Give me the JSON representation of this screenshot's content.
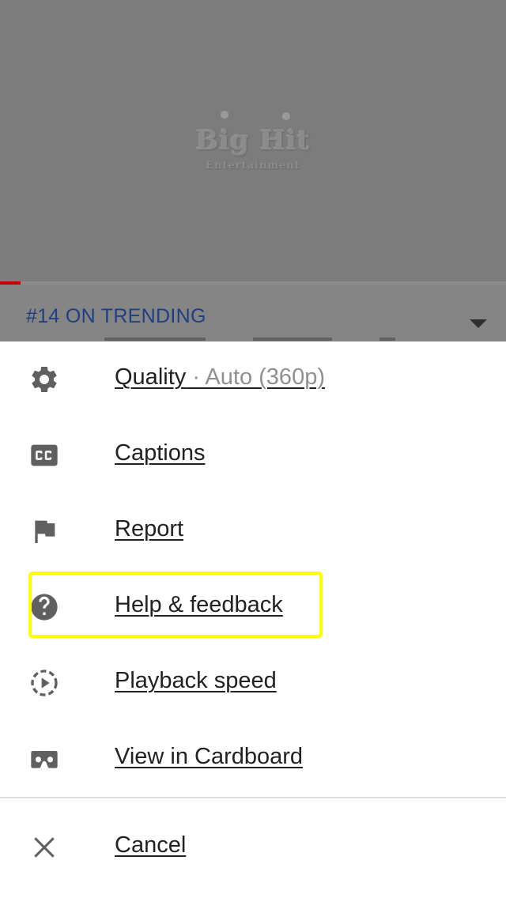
{
  "video": {
    "logo_main": "Big Hit",
    "logo_sub": "Entertainment",
    "progress_fraction": 0.04
  },
  "info": {
    "trending_label": "#14 ON TRENDING"
  },
  "menu": {
    "items": [
      {
        "label": "Quality",
        "sub": " · Auto (360p)",
        "icon": "gear-icon"
      },
      {
        "label": "Captions",
        "icon": "closed-captions-icon"
      },
      {
        "label": "Report",
        "icon": "flag-icon"
      },
      {
        "label": "Help & feedback",
        "icon": "help-icon"
      },
      {
        "label": "Playback speed",
        "icon": "playback-speed-icon"
      },
      {
        "label": "View in Cardboard",
        "icon": "cardboard-vr-icon"
      }
    ],
    "cancel_label": "Cancel"
  },
  "colors": {
    "accent_highlight": "#ffff00",
    "trending_text": "#1f3f84",
    "progress": "#c40000",
    "icon": "#606060"
  }
}
